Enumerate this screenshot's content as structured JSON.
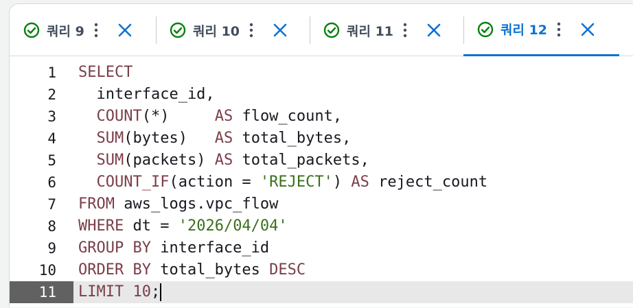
{
  "tabs": [
    {
      "label": "쿼리 9",
      "status": "check-circle-icon"
    },
    {
      "label": "쿼리 10",
      "status": "check-circle-icon"
    },
    {
      "label": "쿼리 11",
      "status": "check-circle-icon"
    },
    {
      "label": "쿼리 12",
      "status": "check-circle-icon",
      "active": true
    }
  ],
  "colors": {
    "accent": "#0972d3",
    "success": "#037f0c",
    "keyword": "#7a3e48",
    "string": "#3b6f1c"
  },
  "editor": {
    "active_line": 11,
    "lines": [
      {
        "n": "1",
        "tokens": [
          [
            "kw",
            "SELECT"
          ]
        ]
      },
      {
        "n": "2",
        "tokens": [
          [
            "t",
            "  interface_id,"
          ]
        ]
      },
      {
        "n": "3",
        "tokens": [
          [
            "t",
            "  "
          ],
          [
            "fn",
            "COUNT"
          ],
          [
            "t",
            "(*)     "
          ],
          [
            "kw",
            "AS"
          ],
          [
            "t",
            " flow_count,"
          ]
        ]
      },
      {
        "n": "4",
        "tokens": [
          [
            "t",
            "  "
          ],
          [
            "fn",
            "SUM"
          ],
          [
            "t",
            "(bytes)   "
          ],
          [
            "kw",
            "AS"
          ],
          [
            "t",
            " total_bytes,"
          ]
        ]
      },
      {
        "n": "5",
        "tokens": [
          [
            "t",
            "  "
          ],
          [
            "fn",
            "SUM"
          ],
          [
            "t",
            "(packets) "
          ],
          [
            "kw",
            "AS"
          ],
          [
            "t",
            " total_packets,"
          ]
        ]
      },
      {
        "n": "6",
        "tokens": [
          [
            "t",
            "  "
          ],
          [
            "fn",
            "COUNT_IF"
          ],
          [
            "t",
            "(action = "
          ],
          [
            "str",
            "'REJECT'"
          ],
          [
            "t",
            ") "
          ],
          [
            "kw",
            "AS"
          ],
          [
            "t",
            " reject_count"
          ]
        ]
      },
      {
        "n": "7",
        "tokens": [
          [
            "kw",
            "FROM"
          ],
          [
            "t",
            " aws_logs.vpc_flow"
          ]
        ]
      },
      {
        "n": "8",
        "tokens": [
          [
            "kw",
            "WHERE"
          ],
          [
            "t",
            " dt = "
          ],
          [
            "str",
            "'2026/04/04'"
          ]
        ]
      },
      {
        "n": "9",
        "tokens": [
          [
            "kw",
            "GROUP BY"
          ],
          [
            "t",
            " interface_id"
          ]
        ]
      },
      {
        "n": "10",
        "tokens": [
          [
            "kw",
            "ORDER BY"
          ],
          [
            "t",
            " total_bytes "
          ],
          [
            "kw",
            "DESC"
          ]
        ]
      },
      {
        "n": "11",
        "tokens": [
          [
            "kw",
            "LIMIT"
          ],
          [
            "t",
            " "
          ],
          [
            "num",
            "10"
          ],
          [
            "t",
            ";"
          ]
        ]
      }
    ]
  }
}
